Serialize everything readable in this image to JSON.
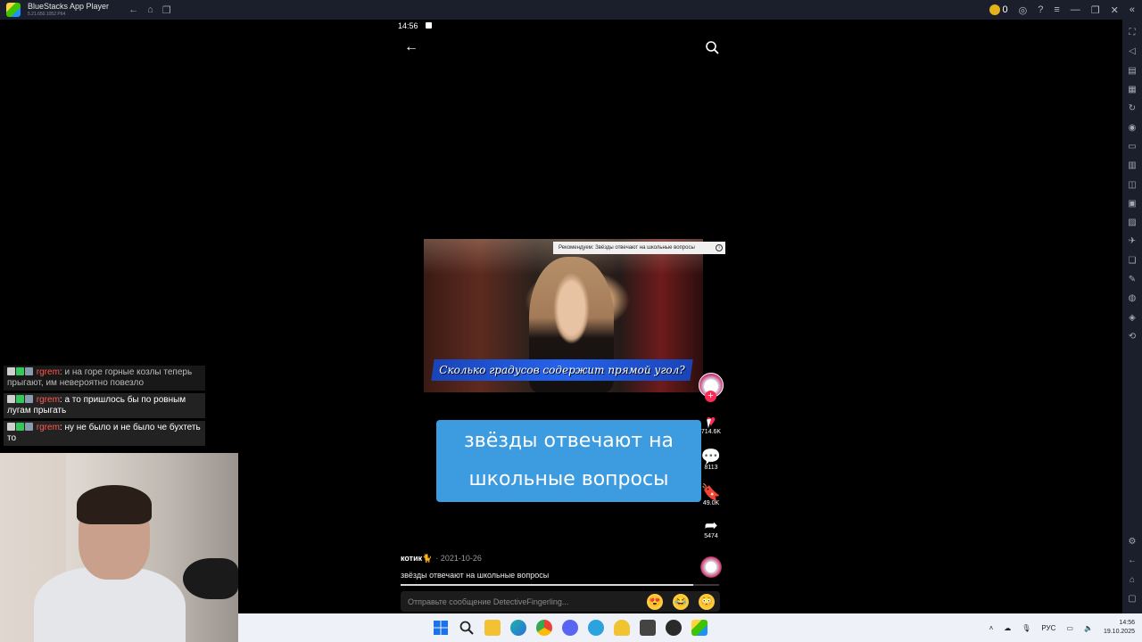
{
  "window": {
    "app_name": "BlueStacks App Player",
    "version": "5.21.650.1052 P64",
    "coins": "0"
  },
  "phone": {
    "status_time": "14:56"
  },
  "video": {
    "recommend_banner": "Рекомендуем: Звёзды отвечают на школьные вопросы",
    "caption_in_video": "Сколько градусов содержит прямой угол?",
    "title_line1": "звёзды отвечают на",
    "title_line2": "школьные вопросы",
    "author": "котик🐈",
    "date": "· 2021-10-26",
    "description": "звёзды отвечают на школьные вопросы",
    "progress": 0.92
  },
  "actions": {
    "likes": "714.6K",
    "comments": "8113",
    "saves": "49.0K",
    "shares": "5474"
  },
  "comment_input": {
    "placeholder": "Отправьте сообщение DetectiveFingerling..."
  },
  "emojis": [
    "😍",
    "😂",
    "😳"
  ],
  "chat": [
    {
      "user": "rgrem",
      "text": "и на горе горные козлы теперь прыгают, им невероятно повезло"
    },
    {
      "user": "rgrem",
      "text": "а то пришлось бы по ровным лугам прыгать"
    },
    {
      "user": "rgrem",
      "text": "ну не было и не было че бухтеть то"
    }
  ],
  "taskbar": {
    "language": "РУС",
    "time": "14:56",
    "date": "19.10.2025"
  }
}
